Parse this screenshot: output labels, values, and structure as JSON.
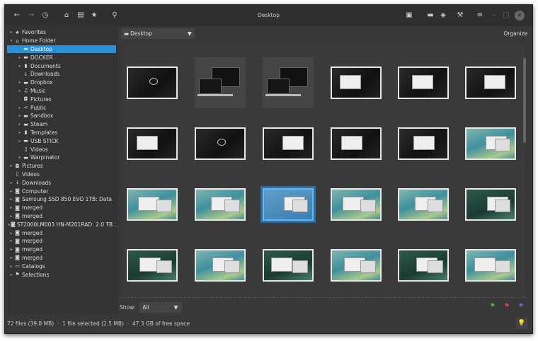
{
  "window": {
    "title": "Desktop"
  },
  "toolbar": {
    "left_icons": [
      "back-arrow-icon",
      "forward-arrow-icon",
      "history-icon",
      "home-icon",
      "drive-icon",
      "star-icon",
      "search-icon"
    ],
    "right_icons": [
      "presentation-icon",
      "comment-icon",
      "tag-icon",
      "wrench-icon",
      "menu-icon"
    ]
  },
  "sidebar": {
    "items": [
      {
        "label": "Favorites",
        "icon": "★",
        "level": 0,
        "arrow": "▸"
      },
      {
        "label": "Home Folder",
        "icon": "⌂",
        "level": 0,
        "arrow": "▾"
      },
      {
        "label": "Desktop",
        "icon": "▬",
        "level": 1,
        "arrow": "",
        "selected": true
      },
      {
        "label": "DOCKER",
        "icon": "▬",
        "level": 1,
        "arrow": "▸"
      },
      {
        "label": "Documents",
        "icon": "▮",
        "level": 1,
        "arrow": "▸"
      },
      {
        "label": "Downloads",
        "icon": "↓",
        "level": 1,
        "arrow": ""
      },
      {
        "label": "Dropbox",
        "icon": "▬",
        "level": 1,
        "arrow": "▸"
      },
      {
        "label": "Music",
        "icon": "♫",
        "level": 1,
        "arrow": "▸"
      },
      {
        "label": "Pictures",
        "icon": "◘",
        "level": 1,
        "arrow": ""
      },
      {
        "label": "Public",
        "icon": "<",
        "level": 1,
        "arrow": "▸"
      },
      {
        "label": "Sandbox",
        "icon": "▬",
        "level": 1,
        "arrow": "▸"
      },
      {
        "label": "Steam",
        "icon": "▬",
        "level": 1,
        "arrow": "▸"
      },
      {
        "label": "Templates",
        "icon": "▮",
        "level": 1,
        "arrow": "▸"
      },
      {
        "label": "USB STICK",
        "icon": "▬",
        "level": 1,
        "arrow": "▸"
      },
      {
        "label": "Videos",
        "icon": "▯",
        "level": 1,
        "arrow": ""
      },
      {
        "label": "Warpinator",
        "icon": "▬",
        "level": 1,
        "arrow": "▸"
      },
      {
        "label": "Pictures",
        "icon": "◘",
        "level": 0,
        "arrow": "▸"
      },
      {
        "label": "Videos",
        "icon": "▯",
        "level": 0,
        "arrow": ""
      },
      {
        "label": "Downloads",
        "icon": "↓",
        "level": 0,
        "arrow": "▸"
      },
      {
        "label": "Computer",
        "icon": "◙",
        "level": 0,
        "arrow": "▸"
      },
      {
        "label": "Samsung SSD 850 EVO 1TB: Data",
        "icon": "◙",
        "level": 0,
        "arrow": "▸"
      },
      {
        "label": "merged",
        "icon": "◙",
        "level": 0,
        "arrow": "▸"
      },
      {
        "label": "merged",
        "icon": "◙",
        "level": 0,
        "arrow": "▸"
      },
      {
        "label": "ST2000LM003 HN-M201RAD: 2.0 TB ...",
        "icon": "◙",
        "level": 0,
        "arrow": "▸"
      },
      {
        "label": "merged",
        "icon": "◙",
        "level": 0,
        "arrow": "▸"
      },
      {
        "label": "merged",
        "icon": "◙",
        "level": 0,
        "arrow": "▸"
      },
      {
        "label": "merged",
        "icon": "◙",
        "level": 0,
        "arrow": "▸"
      },
      {
        "label": "merged",
        "icon": "◙",
        "level": 0,
        "arrow": "▸"
      },
      {
        "label": "Catalogs",
        "icon": "▭",
        "level": 0,
        "arrow": "▸"
      },
      {
        "label": "Selections",
        "icon": "⚑",
        "level": 0,
        "arrow": "▸"
      }
    ]
  },
  "main": {
    "path": "Desktop",
    "organize": "Organize",
    "thumbnails": [
      "dark",
      "device",
      "device",
      "dark-window",
      "dark-window",
      "dark-window",
      "dark-window",
      "dark",
      "dark-window",
      "dark-window",
      "dark-window",
      "teal",
      "teal",
      "teal",
      "selected",
      "teal",
      "teal",
      "teal-dark",
      "teal-dark",
      "teal",
      "teal-dark",
      "teal",
      "teal-dark",
      "teal"
    ],
    "show_label": "Show:",
    "show_value": "All",
    "flags": [
      {
        "icon": "flag-icon",
        "color": "#4caf50"
      },
      {
        "icon": "flag-icon",
        "color": "#e0404a"
      },
      {
        "icon": "flag-icon",
        "color": "#5b6fd0"
      }
    ]
  },
  "status": {
    "text": "72 files (39.8 MB)  ·  1 file selected (2.5 MB)  ·  47.3 GB of free space"
  }
}
